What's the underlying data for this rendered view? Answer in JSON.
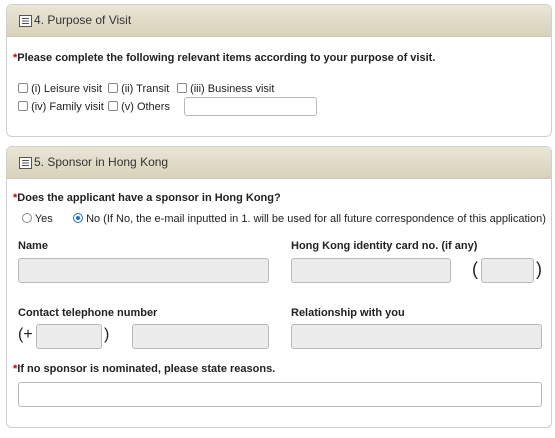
{
  "section4": {
    "title": "4. Purpose of Visit",
    "instruction": "Please complete the following relevant items according to your purpose of visit.",
    "required_mark": "*",
    "options": [
      {
        "label": "(i) Leisure visit",
        "checked": false
      },
      {
        "label": "(ii) Transit",
        "checked": false
      },
      {
        "label": "(iii) Business visit",
        "checked": false
      },
      {
        "label": "(iv) Family visit",
        "checked": false
      },
      {
        "label": "(v) Others",
        "checked": false
      }
    ],
    "others_value": ""
  },
  "section5": {
    "title": "5. Sponsor in Hong Kong",
    "required_mark": "*",
    "sponsor_question": "Does the applicant have a sponsor in Hong Kong?",
    "radio_yes": "Yes",
    "radio_no": "No (If No, the e-mail inputted in 1. will be used for all future correspondence of this application)",
    "selected": "No",
    "name_label": "Name",
    "name_value": "",
    "hkid_label": "Hong Kong identity card no. (if any)",
    "hkid_value": "",
    "hkid_check_value": "",
    "hkid_open_paren": "(",
    "hkid_close_paren": ")",
    "phone_label": "Contact telephone number",
    "phone_prefix": "(+",
    "phone_prefix_close": ")",
    "phone_code_value": "",
    "phone_number_value": "",
    "relationship_label": "Relationship with you",
    "relationship_value": "",
    "reason_label": "If no sponsor is nominated, please state reasons.",
    "reason_value": ""
  },
  "colors": {
    "header_bg": "#d8d2ba",
    "required": "#cc0000",
    "input_disabled_bg": "#ececec",
    "radio_selected": "#1a6fd6"
  },
  "icons": {
    "section_icon": "list-icon"
  }
}
